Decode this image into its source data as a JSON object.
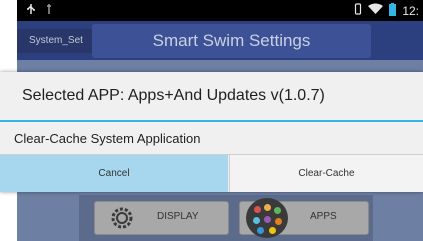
{
  "status_bar": {
    "time": "12:",
    "icons": [
      "usb-icon",
      "usb-debug-icon",
      "vibrate-icon",
      "wifi-icon",
      "battery-icon"
    ],
    "battery_color": "#33b5e5"
  },
  "app": {
    "tab_label": "System_Set",
    "title": "Smart Swim Settings",
    "tiles": [
      {
        "label": "DISPLAY",
        "icon": "gear-icon"
      },
      {
        "label": "APPS",
        "icon": "apps-icon"
      }
    ]
  },
  "dialog": {
    "title": "Selected APP: Apps+And Updates  v(1.0.7)",
    "message": "Clear-Cache System Application",
    "cancel_label": "Cancel",
    "clear_label": "Clear-Cache",
    "accent_color": "#33b5e5",
    "cancel_highlight": "#a7d7ee"
  }
}
